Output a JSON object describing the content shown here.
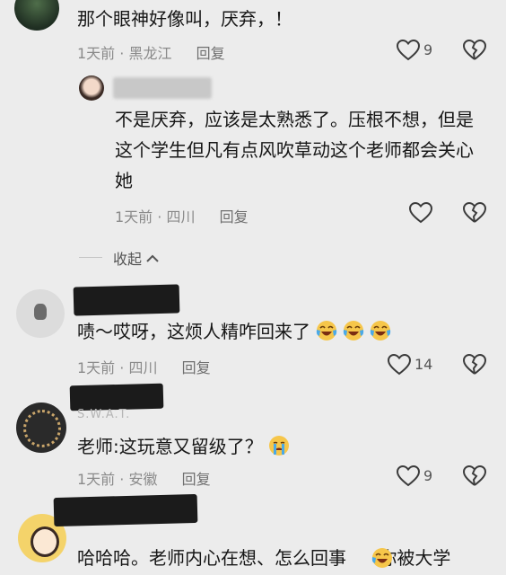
{
  "comments": [
    {
      "text": "那个眼神好像叫，厌弃，！",
      "time": "1天前",
      "location": "黑龙江",
      "reply_label": "回复",
      "likes": "9"
    },
    {
      "text": "不是厌弃，应该是太熟悉了。压根不想，但是这个学生但凡有点风吹草动这个老师都会关心她",
      "time": "1天前",
      "location": "四川",
      "reply_label": "回复",
      "likes": ""
    },
    {
      "text": "啧～哎呀，这烦人精咋回来了",
      "time": "1天前",
      "location": "四川",
      "reply_label": "回复",
      "likes": "14"
    },
    {
      "username_fragment": "S.W.A.T.",
      "text": "老师:这玩意又留级了？",
      "time": "1天前",
      "location": "安徽",
      "reply_label": "回复",
      "likes": "9"
    },
    {
      "text": "哈哈哈。老师内心在想、怎么回事你被大学"
    }
  ],
  "collapse_label": "收起",
  "icons": {
    "like": "heart-outline-icon",
    "dislike": "broken-heart-icon",
    "collapse": "chevron-up-icon",
    "emoji": "laughing-crying-emoji"
  }
}
